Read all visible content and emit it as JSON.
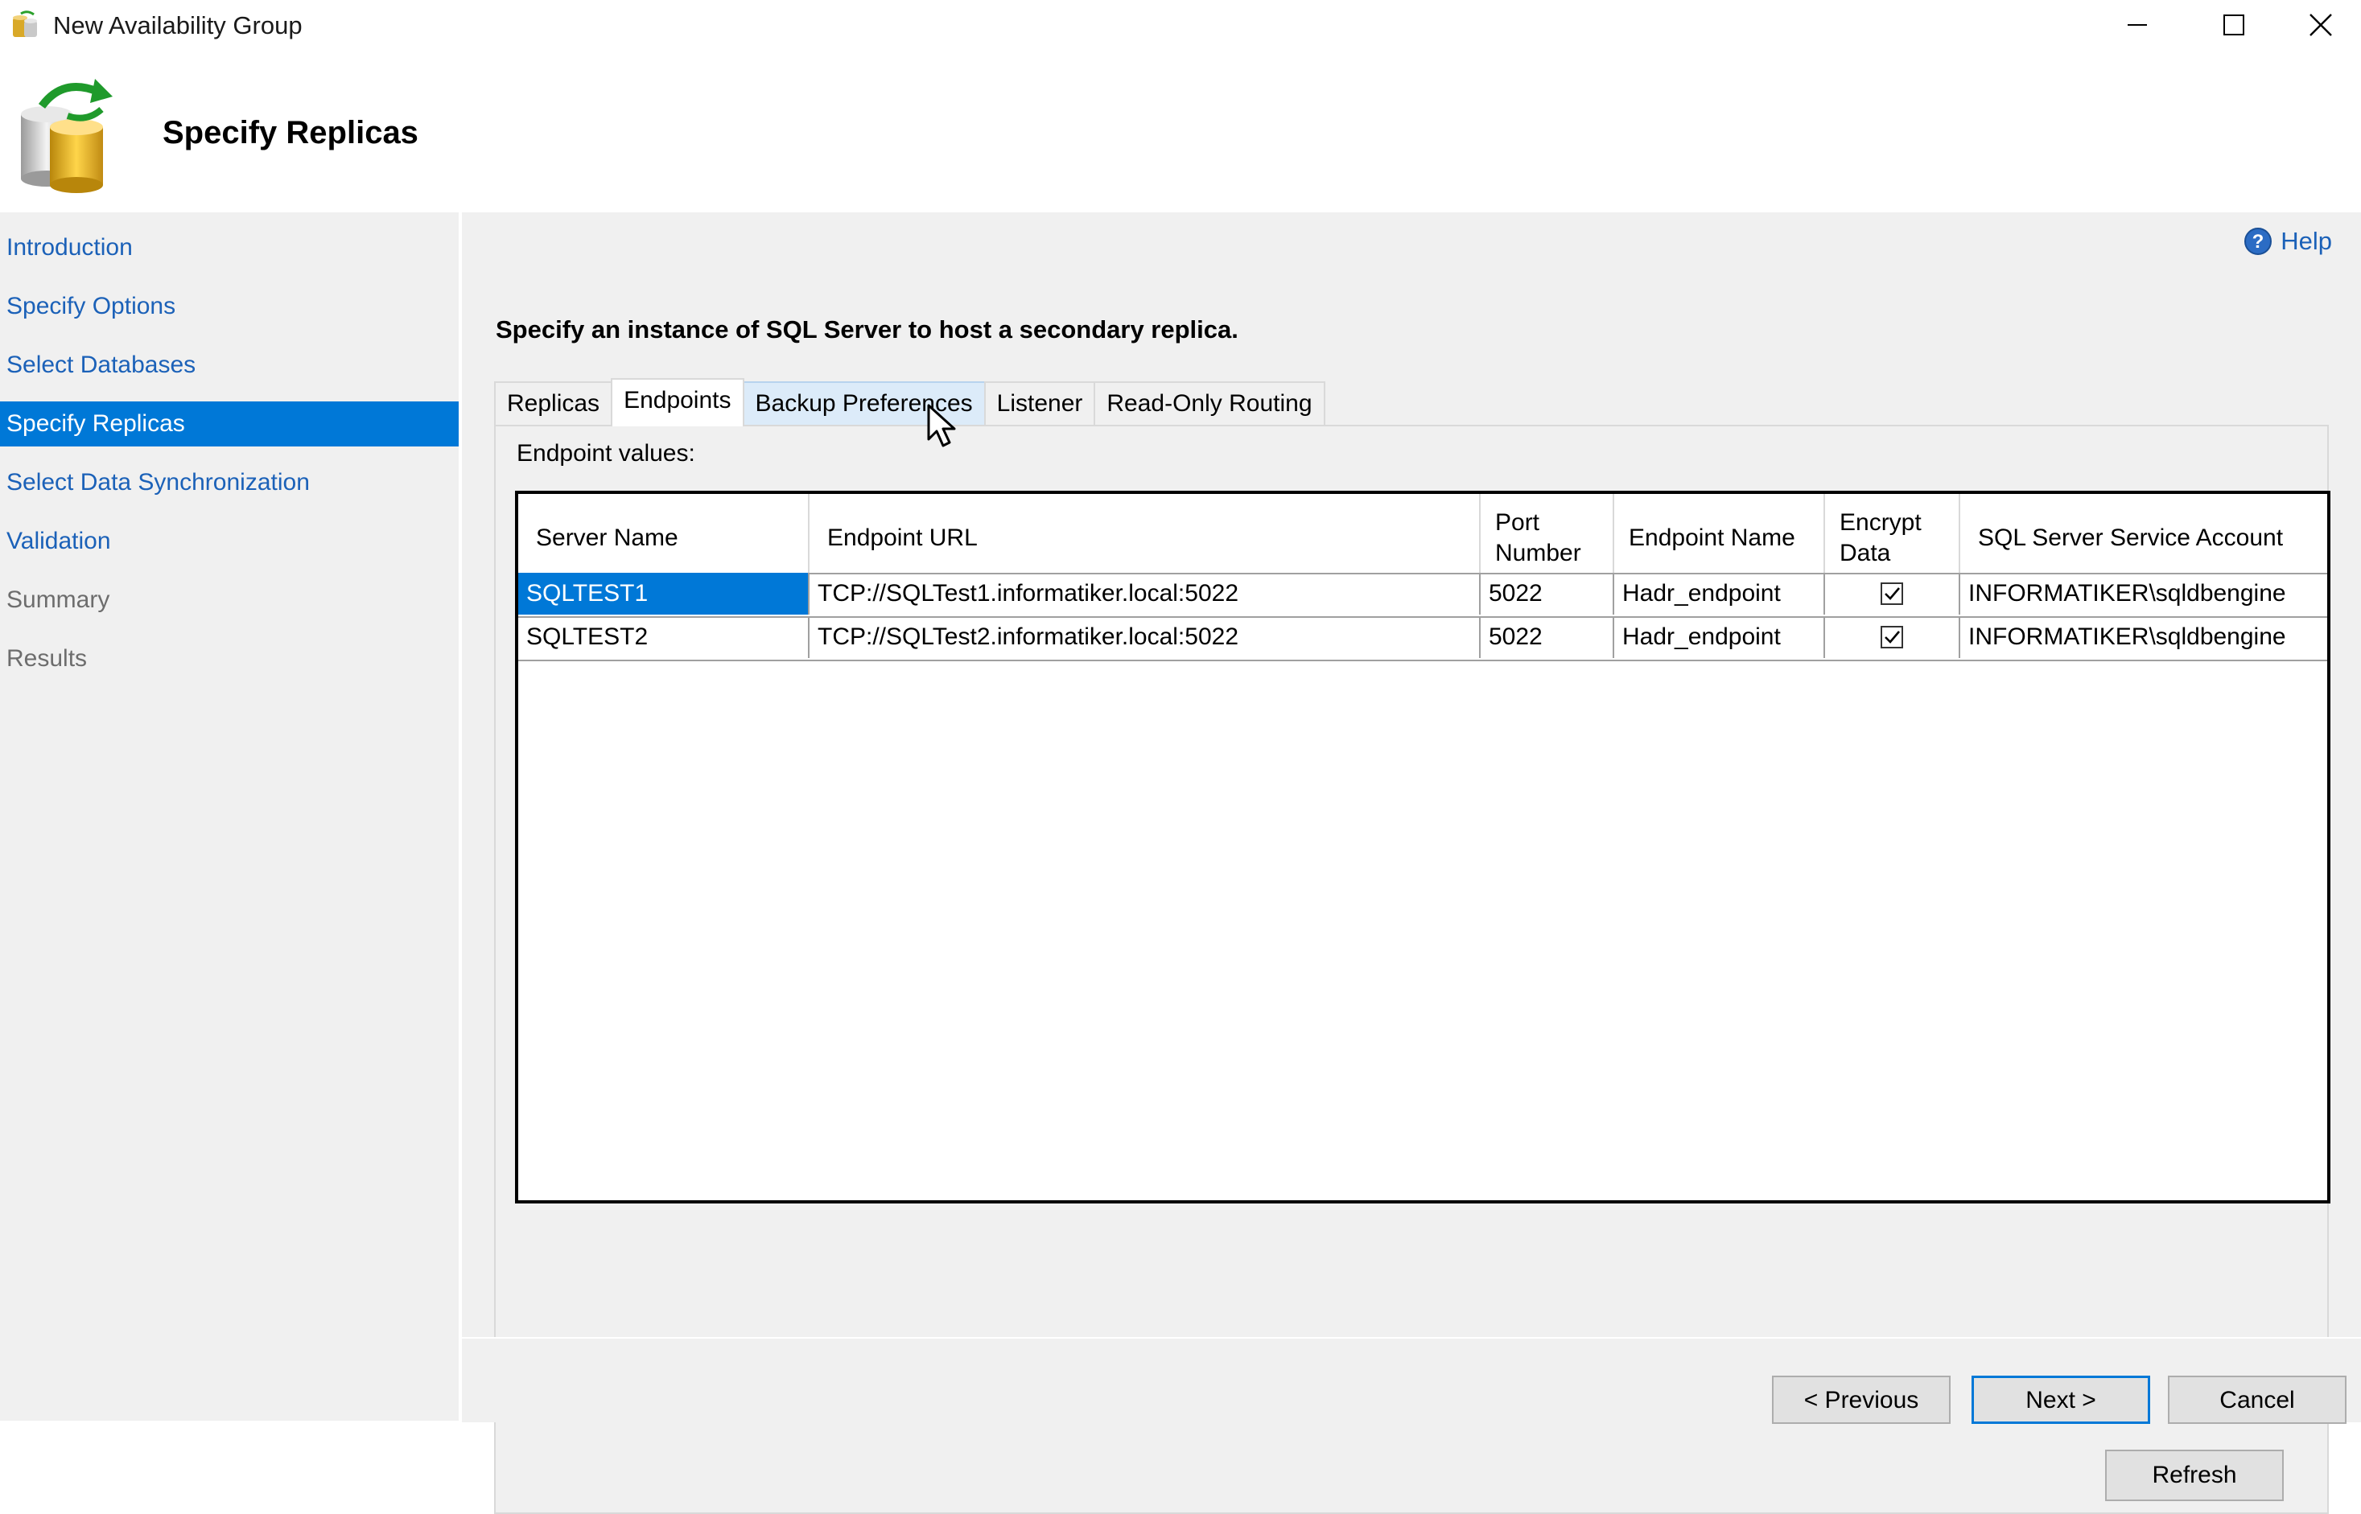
{
  "window": {
    "title": "New Availability Group",
    "icon": "database-wizard-icon"
  },
  "header": {
    "title": "Specify Replicas",
    "icon": "database-refresh-icon"
  },
  "sidebar": {
    "items": [
      {
        "label": "Introduction",
        "state": "link"
      },
      {
        "label": "Specify Options",
        "state": "link"
      },
      {
        "label": "Select Databases",
        "state": "link"
      },
      {
        "label": "Specify Replicas",
        "state": "active"
      },
      {
        "label": "Select Data Synchronization",
        "state": "link"
      },
      {
        "label": "Validation",
        "state": "link"
      },
      {
        "label": "Summary",
        "state": "disabled"
      },
      {
        "label": "Results",
        "state": "disabled"
      }
    ]
  },
  "main": {
    "help_label": "Help",
    "instruction": "Specify an instance of SQL Server to host a secondary replica.",
    "tabs": [
      {
        "label": "Replicas",
        "active": false
      },
      {
        "label": "Endpoints",
        "active": true
      },
      {
        "label": "Backup Preferences",
        "active": false,
        "hovered": true
      },
      {
        "label": "Listener",
        "active": false
      },
      {
        "label": "Read-Only Routing",
        "active": false
      }
    ],
    "panel_label": "Endpoint values:",
    "table": {
      "columns": [
        {
          "label": "Server Name"
        },
        {
          "label": "Endpoint URL"
        },
        {
          "label": "Port Number"
        },
        {
          "label": "Endpoint Name"
        },
        {
          "label": "Encrypt Data"
        },
        {
          "label": "SQL Server Service Account"
        }
      ],
      "rows": [
        {
          "server": "SQLTEST1",
          "url": "TCP://SQLTest1.informatiker.local:5022",
          "port": "5022",
          "endpoint": "Hadr_endpoint",
          "encrypt": true,
          "account": "INFORMATIKER\\sqldbengine",
          "selected": true
        },
        {
          "server": "SQLTEST2",
          "url": "TCP://SQLTest2.informatiker.local:5022",
          "port": "5022",
          "endpoint": "Hadr_endpoint",
          "encrypt": true,
          "account": "INFORMATIKER\\sqldbengine",
          "selected": false
        }
      ]
    },
    "refresh_label": "Refresh"
  },
  "footer": {
    "previous_label": "< Previous",
    "next_label": "Next >",
    "cancel_label": "Cancel"
  },
  "colors": {
    "accent": "#0078d7",
    "link": "#1b61b8",
    "panel_bg": "#f0f0f0"
  }
}
